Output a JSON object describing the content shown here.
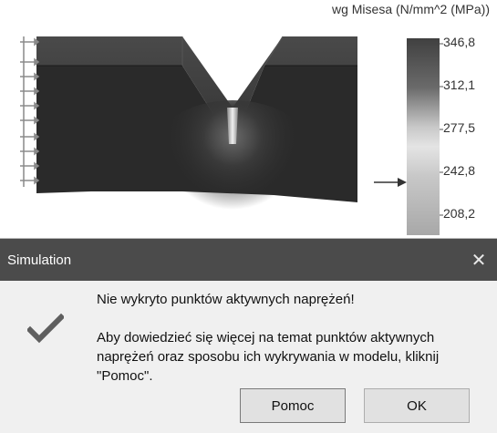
{
  "legend": {
    "title": "wg Misesa (N/mm^2 (MPa))",
    "scale_labels": [
      "346,8",
      "312,1",
      "277,5",
      "242,8",
      "208,2"
    ]
  },
  "dialog": {
    "title": "Simulation",
    "close_glyph": "✕",
    "message_line1": "Nie wykryto punktów aktywnych naprężeń!",
    "message_line2": "Aby dowiedzieć się więcej na temat punktów aktywnych naprężeń oraz sposobu ich wykrywania w modelu, kliknij \"Pomoc\".",
    "icon": "checkmark-icon",
    "buttons": {
      "help": "Pomoc",
      "ok": "OK"
    },
    "colors": {
      "titlebar": "#4b4b4b",
      "body": "#f0f0f0",
      "button": "#e1e1e1"
    }
  }
}
